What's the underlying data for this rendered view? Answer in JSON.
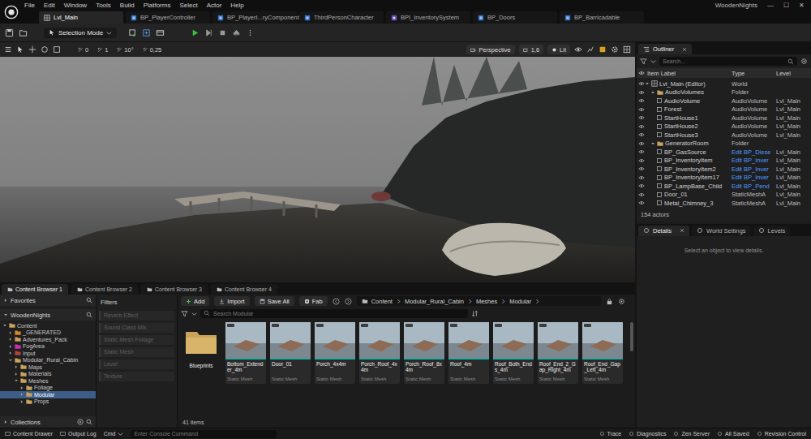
{
  "menu": [
    "File",
    "Edit",
    "Window",
    "Tools",
    "Build",
    "Platforms",
    "Select",
    "Actor",
    "Help"
  ],
  "project": "WoodenNights",
  "window_controls": [
    "—",
    "☐",
    "✕"
  ],
  "tabs": [
    {
      "label": "Lvl_Main",
      "selected": true,
      "kind": "level"
    },
    {
      "label": "BP_PlayerController",
      "selected": false,
      "kind": "blueprint"
    },
    {
      "label": "BP_PlayerI...ryComponent",
      "selected": false,
      "kind": "blueprint"
    },
    {
      "label": "ThirdPersonCharacter",
      "selected": false,
      "kind": "blueprint"
    },
    {
      "label": "BPI_InventorySystem",
      "selected": false,
      "kind": "interface"
    },
    {
      "label": "BP_Doors",
      "selected": false,
      "kind": "blueprint"
    },
    {
      "label": "BP_Barricadable",
      "selected": false,
      "kind": "blueprint"
    }
  ],
  "toolbar": {
    "mode": "Selection Mode"
  },
  "viewport_toolbar": {
    "left": [
      "0",
      "1",
      "10°",
      "0,25"
    ],
    "view": "Perspective",
    "speed": "1,6",
    "lighting": "Lit"
  },
  "outliner": {
    "title": "Outliner",
    "search_placeholder": "Search...",
    "columns": [
      "Item Label",
      "Type",
      "Level"
    ],
    "rows": [
      {
        "label": "Lvl_Main (Editor)",
        "type": "World",
        "level": "",
        "depth": 0,
        "kind": "world",
        "expanded": true,
        "link": false
      },
      {
        "label": "AudioVolumes",
        "type": "Folder",
        "level": "",
        "depth": 1,
        "kind": "folder",
        "expanded": true,
        "link": false
      },
      {
        "label": "AudioVolume",
        "type": "AudioVolume",
        "level": "Lvl_Main",
        "depth": 2,
        "kind": "actor",
        "expanded": false,
        "link": false
      },
      {
        "label": "Forest",
        "type": "AudioVolume",
        "level": "Lvl_Main",
        "depth": 2,
        "kind": "actor",
        "expanded": false,
        "link": false
      },
      {
        "label": "StartHouse1",
        "type": "AudioVolume",
        "level": "Lvl_Main",
        "depth": 2,
        "kind": "actor",
        "expanded": false,
        "link": false
      },
      {
        "label": "StartHouse2",
        "type": "AudioVolume",
        "level": "Lvl_Main",
        "depth": 2,
        "kind": "actor",
        "expanded": false,
        "link": false
      },
      {
        "label": "StartHouse3",
        "type": "AudioVolume",
        "level": "Lvl_Main",
        "depth": 2,
        "kind": "actor",
        "expanded": false,
        "link": false
      },
      {
        "label": "GeneratorRoom",
        "type": "Folder",
        "level": "",
        "depth": 1,
        "kind": "folder",
        "expanded": true,
        "link": false
      },
      {
        "label": "BP_GasSource",
        "type": "Edit BP_Diese",
        "level": "Lvl_Main",
        "depth": 2,
        "kind": "actor",
        "expanded": false,
        "link": true
      },
      {
        "label": "BP_InventoryItem",
        "type": "Edit BP_Inver",
        "level": "Lvl_Main",
        "depth": 2,
        "kind": "actor",
        "expanded": false,
        "link": true
      },
      {
        "label": "BP_InventoryItem2",
        "type": "Edit BP_Inver",
        "level": "Lvl_Main",
        "depth": 2,
        "kind": "actor",
        "expanded": false,
        "link": true
      },
      {
        "label": "BP_InventoryItem17",
        "type": "Edit BP_Inver",
        "level": "Lvl_Main",
        "depth": 2,
        "kind": "actor",
        "expanded": false,
        "link": true
      },
      {
        "label": "BP_LampBase_Child",
        "type": "Edit BP_Pend",
        "level": "Lvl_Main",
        "depth": 2,
        "kind": "actor",
        "expanded": false,
        "link": true
      },
      {
        "label": "Door_01",
        "type": "StaticMeshA",
        "level": "Lvl_Main",
        "depth": 2,
        "kind": "actor",
        "expanded": false,
        "link": false
      },
      {
        "label": "Metal_Chimney_3",
        "type": "StaticMeshA",
        "level": "Lvl_Main",
        "depth": 2,
        "kind": "actor",
        "expanded": false,
        "link": false
      }
    ],
    "count": "154 actors"
  },
  "details": {
    "tabs": [
      {
        "label": "Details",
        "selected": true
      },
      {
        "label": "World Settings",
        "selected": false
      },
      {
        "label": "Levels",
        "selected": false
      }
    ],
    "empty": "Select an object to view details."
  },
  "content_browser": {
    "tabs": [
      {
        "label": "Content Browser 1",
        "selected": true
      },
      {
        "label": "Content Browser 2",
        "selected": false
      },
      {
        "label": "Content Browser 3",
        "selected": false
      },
      {
        "label": "Content Browser 4",
        "selected": false
      }
    ],
    "favorites": "Favorites",
    "project": "WoodenNights",
    "tree": [
      {
        "label": "Content",
        "depth": 0,
        "expanded": true,
        "selected": false,
        "color": "#c9a35c"
      },
      {
        "label": "_GENERATED",
        "depth": 1,
        "expanded": false,
        "selected": false,
        "color": "#d9862a"
      },
      {
        "label": "Adventures_Pack",
        "depth": 1,
        "expanded": false,
        "selected": false,
        "color": "#c9a35c"
      },
      {
        "label": "FogArea",
        "depth": 1,
        "expanded": false,
        "selected": false,
        "color": "#d12fb0"
      },
      {
        "label": "Input",
        "depth": 1,
        "expanded": false,
        "selected": false,
        "color": "#b0433a"
      },
      {
        "label": "Modular_Rural_Cabin",
        "depth": 1,
        "expanded": true,
        "selected": false,
        "color": "#c9a35c"
      },
      {
        "label": "Maps",
        "depth": 2,
        "expanded": false,
        "selected": false,
        "color": "#c9a35c"
      },
      {
        "label": "Materials",
        "depth": 2,
        "expanded": false,
        "selected": false,
        "color": "#c9a35c"
      },
      {
        "label": "Meshes",
        "depth": 2,
        "expanded": true,
        "selected": false,
        "color": "#c9a35c"
      },
      {
        "label": "Foliage",
        "depth": 3,
        "expanded": false,
        "selected": false,
        "color": "#c9a35c"
      },
      {
        "label": "Modular",
        "depth": 3,
        "expanded": false,
        "selected": true,
        "color": "#c9a35c"
      },
      {
        "label": "Props",
        "depth": 3,
        "expanded": false,
        "selected": false,
        "color": "#c9a35c"
      }
    ],
    "collections": "Collections",
    "filters_title": "Filters",
    "filters": [
      {
        "label": "Reverb Effect",
        "active": false
      },
      {
        "label": "Sound Class Mix",
        "active": false
      },
      {
        "label": "Static Mesh Foliage",
        "active": false
      },
      {
        "label": "Static Mesh",
        "active": false
      },
      {
        "label": "Level",
        "active": false
      },
      {
        "label": "Texture",
        "active": false
      }
    ],
    "actions": [
      {
        "label": "Add",
        "kind": "add"
      },
      {
        "label": "Import",
        "kind": "import"
      },
      {
        "label": "Save All",
        "kind": "save"
      },
      {
        "label": "Fab",
        "kind": "fab"
      }
    ],
    "path": [
      "Content",
      "Modular_Rural_Cabin",
      "Meshes",
      "Modular"
    ],
    "search_placeholder": "Search Modular",
    "assets": [
      {
        "name": "Blueprints",
        "kind": "folder"
      },
      {
        "name": "Bottom_Extender_4m",
        "kind": "mesh",
        "type": "Static Mesh"
      },
      {
        "name": "Door_01",
        "kind": "mesh",
        "type": "Static Mesh"
      },
      {
        "name": "Porch_4x4m",
        "kind": "mesh",
        "type": "Static Mesh"
      },
      {
        "name": "Porch_Roof_4x4m",
        "kind": "mesh",
        "type": "Static Mesh"
      },
      {
        "name": "Porch_Roof_8x4m",
        "kind": "mesh",
        "type": "Static Mesh"
      },
      {
        "name": "Roof_4m",
        "kind": "mesh",
        "type": "Static Mesh"
      },
      {
        "name": "Roof_Both_Ends_4m",
        "kind": "mesh",
        "type": "Static Mesh"
      },
      {
        "name": "Roof_End_2_Gap_Right_4m",
        "kind": "mesh",
        "type": "Static Mesh"
      },
      {
        "name": "Roof_End_Gap_Left_4m",
        "kind": "mesh",
        "type": "Static Mesh"
      }
    ],
    "count": "41 items"
  },
  "status_bar": {
    "left": [
      "Content Drawer",
      "Output Log"
    ],
    "cmd": "Cmd",
    "console_placeholder": "Enter Console Command",
    "right": [
      "Trace",
      "Diagnostics",
      "Zen Server",
      "All Saved",
      "Revision Control"
    ]
  }
}
